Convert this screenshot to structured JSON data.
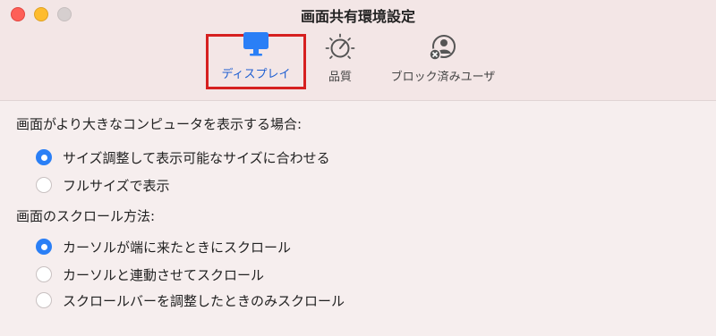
{
  "window": {
    "title": "画面共有環境設定",
    "accent_color": "#2a7ff6",
    "highlight_border_color": "#d62020"
  },
  "toolbar": {
    "tabs": [
      {
        "label": "ディスプレイ",
        "icon": "display-icon",
        "selected": true
      },
      {
        "label": "品質",
        "icon": "quality-dial-icon",
        "selected": false
      },
      {
        "label": "ブロック済みユーザ",
        "icon": "blocked-user-icon",
        "selected": false
      }
    ]
  },
  "display_size": {
    "heading": "画面がより大きなコンピュータを表示する場合:",
    "options": [
      {
        "label": "サイズ調整して表示可能なサイズに合わせる",
        "checked": true
      },
      {
        "label": "フルサイズで表示",
        "checked": false
      }
    ]
  },
  "scroll": {
    "heading": "画面のスクロール方法:",
    "options": [
      {
        "label": "カーソルが端に来たときにスクロール",
        "checked": true
      },
      {
        "label": "カーソルと連動させてスクロール",
        "checked": false
      },
      {
        "label": "スクロールバーを調整したときのみスクロール",
        "checked": false
      }
    ]
  }
}
